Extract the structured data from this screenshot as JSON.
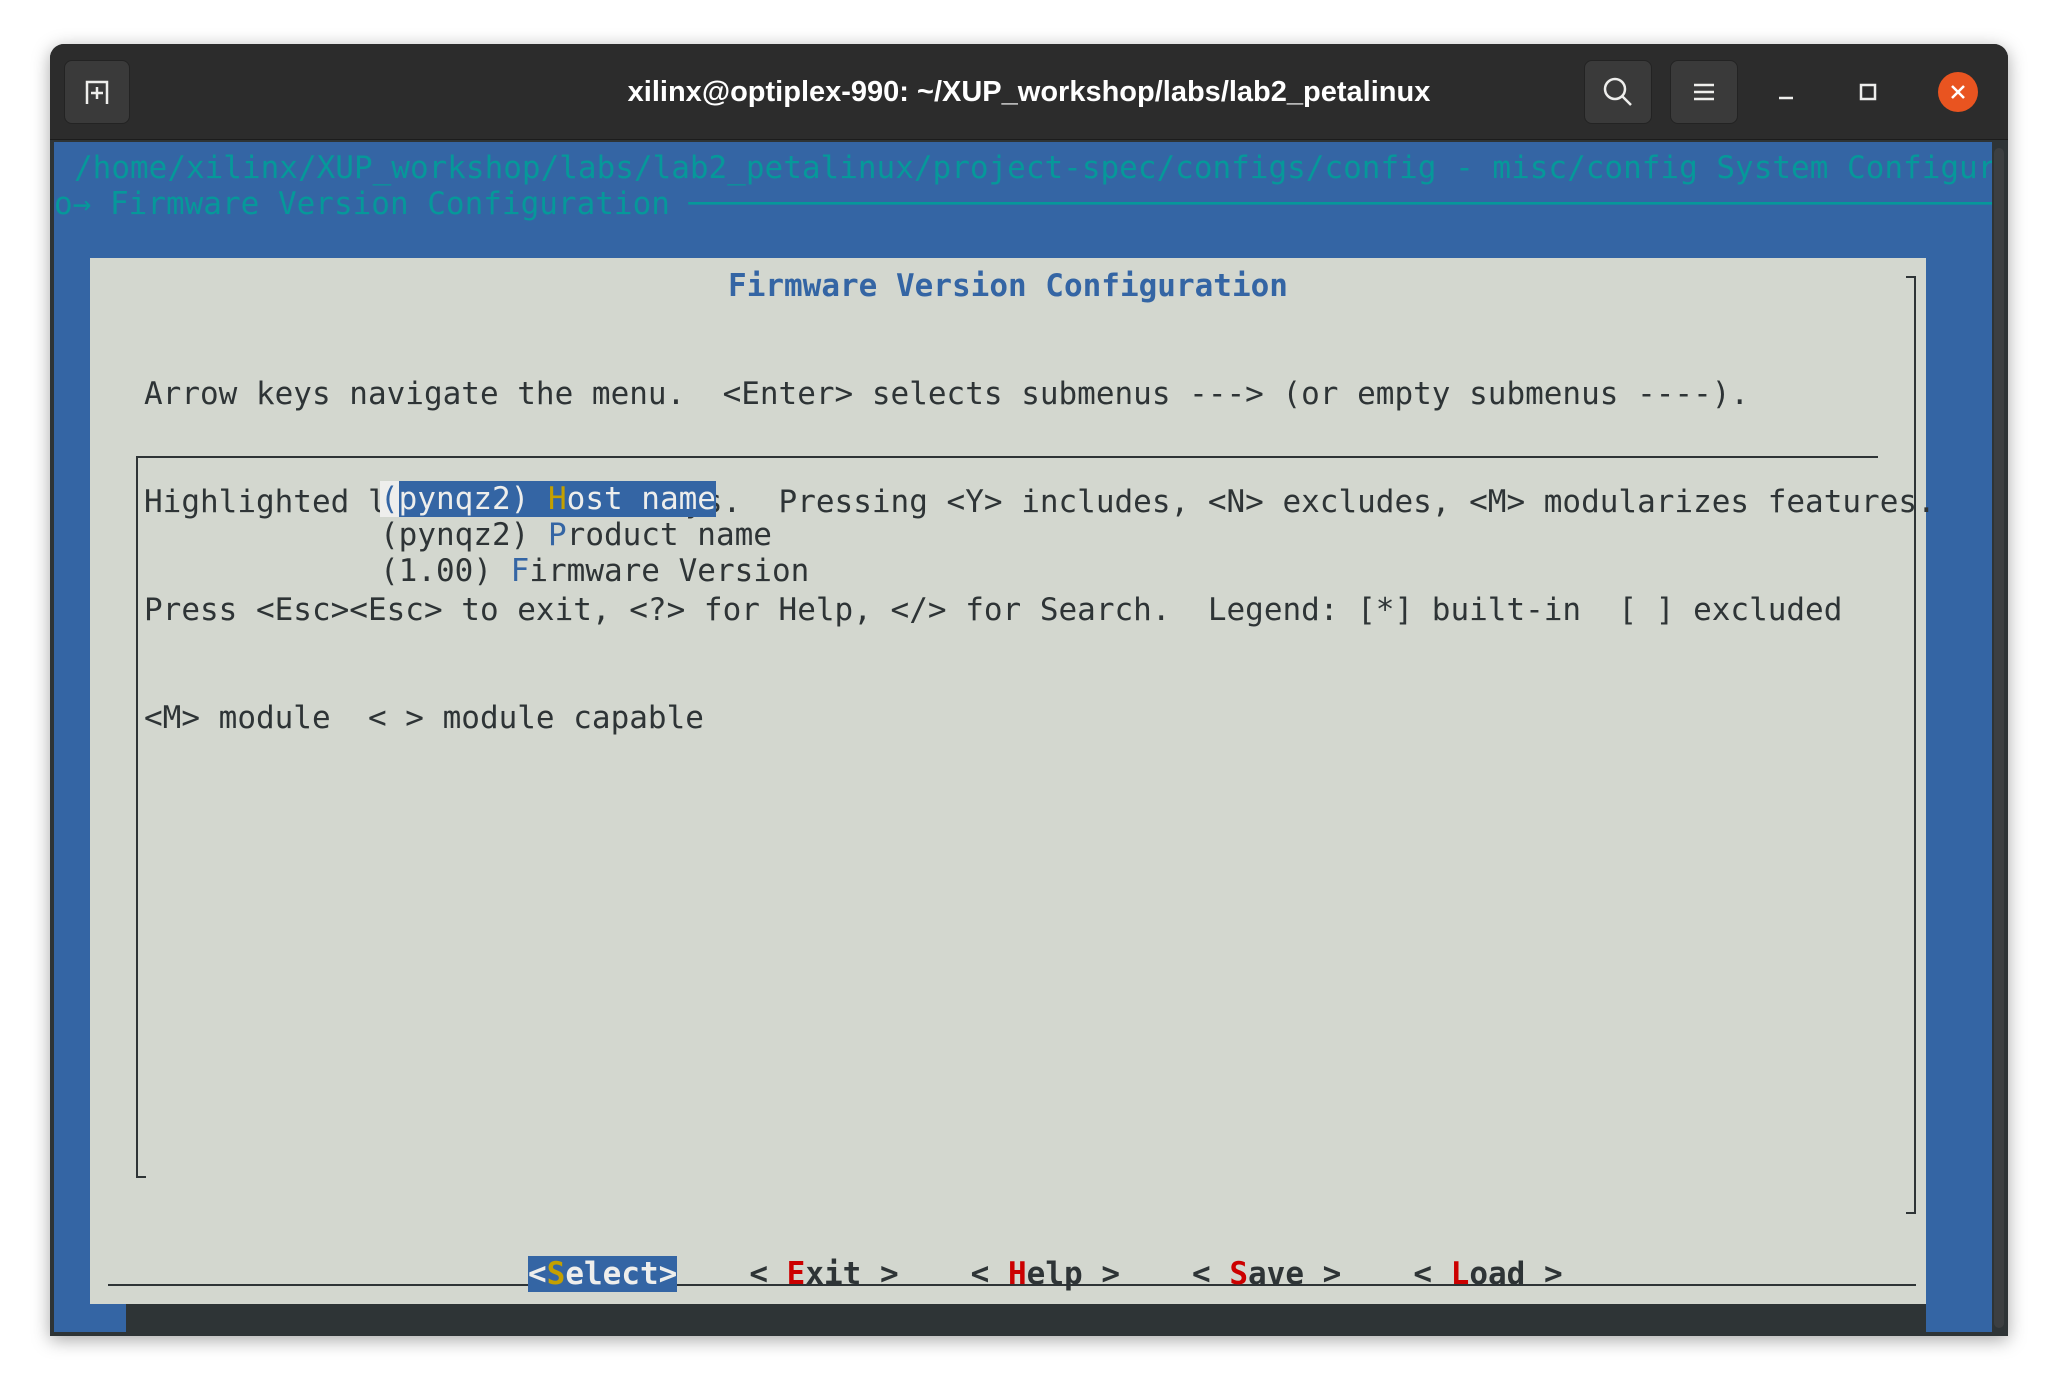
{
  "window": {
    "title": "xilinx@optiplex-990: ~/XUP_workshop/labs/lab2_petalinux"
  },
  "terminal": {
    "path_line": "/home/xilinx/XUP_workshop/labs/lab2_petalinux/project-spec/configs/config - misc/config System Configurati",
    "breadcrumb_line": "o→ Firmware Version Configuration ────────────────────────────────────────────────────────────────────────"
  },
  "dialog": {
    "title": "Firmware Version Configuration",
    "help_lines": [
      "Arrow keys navigate the menu.  <Enter> selects submenus ---> (or empty submenus ----).",
      "Highlighted letters are hotkeys.  Pressing <Y> includes, <N> excludes, <M> modularizes features.",
      "Press <Esc><Esc> to exit, <?> for Help, </> for Search.  Legend: [*] built-in  [ ] excluded",
      "<M> module  < > module capable"
    ],
    "items": [
      {
        "cursor": "(",
        "value_rest": "pynqz2) ",
        "hotkey": "H",
        "rest": "ost name",
        "selected": true
      },
      {
        "value": "(pynqz2) ",
        "hotkey": "P",
        "rest": "roduct name",
        "selected": false
      },
      {
        "value": "(1.00) ",
        "hotkey": "F",
        "rest": "irmware Version",
        "selected": false
      }
    ],
    "buttons": [
      {
        "pre": "<",
        "hotkey": "S",
        "rest": "elect",
        "post": ">",
        "selected": true
      },
      {
        "pre": "< ",
        "hotkey": "E",
        "rest": "xit",
        "post": " >",
        "selected": false
      },
      {
        "pre": "< ",
        "hotkey": "H",
        "rest": "elp",
        "post": " >",
        "selected": false
      },
      {
        "pre": "< ",
        "hotkey": "S",
        "rest": "ave",
        "post": " >",
        "selected": false
      },
      {
        "pre": "< ",
        "hotkey": "L",
        "rest": "oad",
        "post": " >",
        "selected": false
      }
    ]
  },
  "colors": {
    "background": "#3465a4",
    "dialog": "#d3d7cf",
    "title_text": "#3465a4",
    "hotkey": "#cc0000",
    "selected_hotkey": "#c4a000",
    "close_button": "#e95420"
  }
}
